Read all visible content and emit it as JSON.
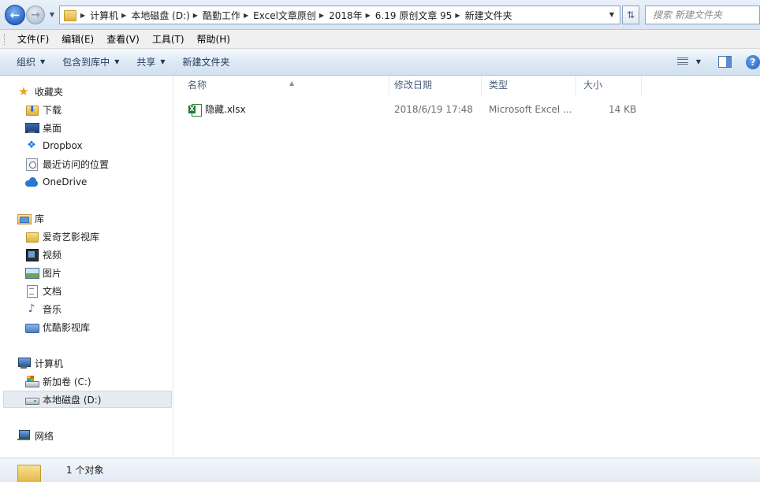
{
  "address_bar": {
    "breadcrumbs": [
      "计算机",
      "本地磁盘 (D:)",
      "酷勤工作",
      "Excel文章原创",
      "2018年",
      "6.19 原创文章 95",
      "新建文件夹"
    ],
    "search_placeholder": "搜索 新建文件夹"
  },
  "menu": {
    "items": [
      "文件(F)",
      "编辑(E)",
      "查看(V)",
      "工具(T)",
      "帮助(H)"
    ]
  },
  "toolbar": {
    "organize": "组织",
    "include_in_library": "包含到库中",
    "share": "共享",
    "new_folder": "新建文件夹",
    "help": "?"
  },
  "nav": {
    "favorites": {
      "label": "收藏夹",
      "items": [
        "下载",
        "桌面",
        "Dropbox",
        "最近访问的位置",
        "OneDrive"
      ]
    },
    "libraries": {
      "label": "库",
      "items": [
        "爱奇艺影视库",
        "视频",
        "图片",
        "文档",
        "音乐",
        "优酷影视库"
      ]
    },
    "computer": {
      "label": "计算机",
      "items": [
        "新加卷 (C:)",
        "本地磁盘 (D:)"
      ],
      "selected": "本地磁盘 (D:)"
    },
    "network": {
      "label": "网络"
    }
  },
  "file_list": {
    "columns": [
      "名称",
      "修改日期",
      "类型",
      "大小"
    ],
    "rows": [
      {
        "name": "隐藏.xlsx",
        "modified": "2018/6/19 17:48",
        "type": "Microsoft Excel ...",
        "size": "14 KB"
      }
    ]
  },
  "status": {
    "text": "1 个对象"
  },
  "colors": {
    "accent": "#2a66c4",
    "selection": "#e6ebf1",
    "header_text": "#4c607a"
  }
}
